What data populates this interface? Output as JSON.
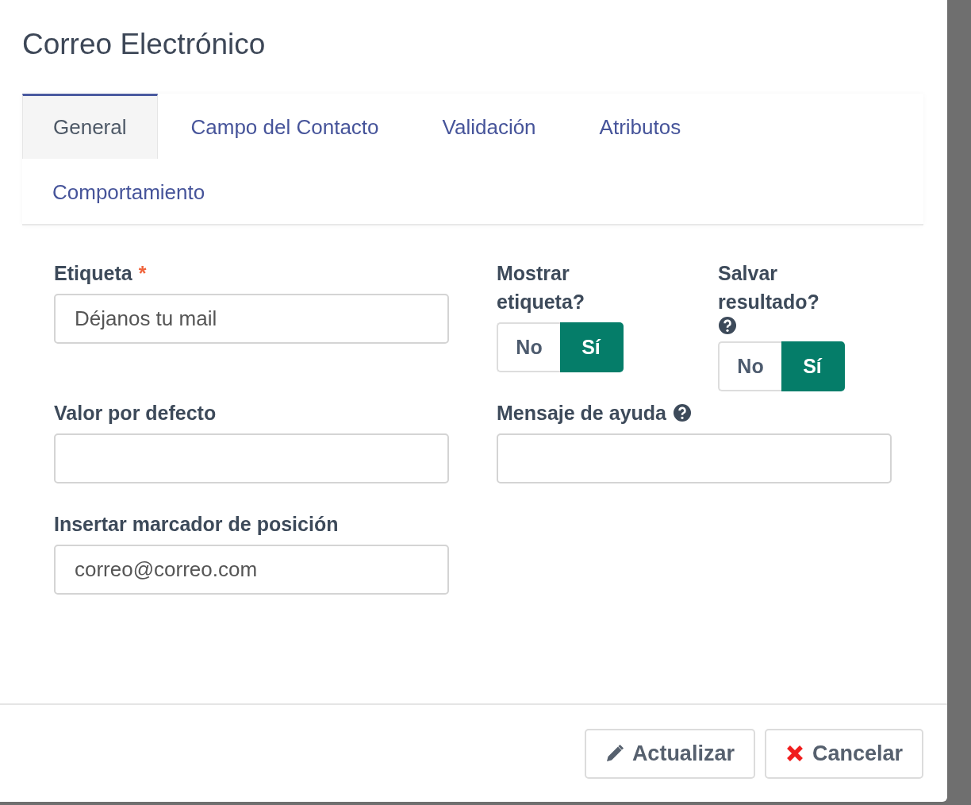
{
  "dialog": {
    "title": "Correo Electrónico"
  },
  "tabs": [
    {
      "label": "General",
      "selected": true
    },
    {
      "label": "Campo del Contacto",
      "selected": false
    },
    {
      "label": "Validación",
      "selected": false
    },
    {
      "label": "Atributos",
      "selected": false
    },
    {
      "label": "Comportamiento",
      "selected": false
    }
  ],
  "form": {
    "label_field": {
      "label": "Etiqueta",
      "required_mark": "*",
      "value": "Déjanos tu mail"
    },
    "show_label": {
      "label": "Mostrar etiqueta?",
      "options": [
        {
          "label": "No",
          "selected": false
        },
        {
          "label": "Sí",
          "selected": true
        }
      ]
    },
    "save_result": {
      "label": "Salvar resultado?",
      "help": true,
      "options": [
        {
          "label": "No",
          "selected": false
        },
        {
          "label": "Sí",
          "selected": true
        }
      ]
    },
    "default_value": {
      "label": "Valor por defecto"
    },
    "help_message": {
      "label": "Mensaje de ayuda",
      "help": true
    },
    "placeholder_field": {
      "label": "Insertar marcador de posición",
      "value": "correo@correo.com"
    }
  },
  "buttons": [
    {
      "label": "Actualizar",
      "kind": "update"
    },
    {
      "label": "Cancelar",
      "kind": "cancel"
    }
  ]
}
